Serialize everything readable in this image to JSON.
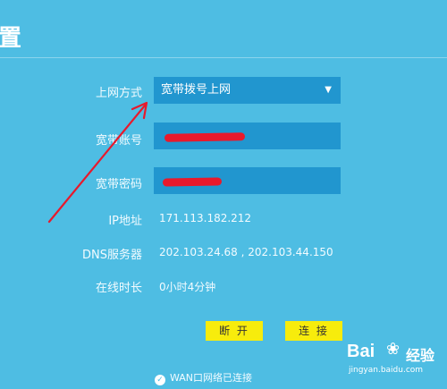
{
  "header": {
    "title": "置"
  },
  "form": {
    "connection_type_label": "上网方式",
    "connection_type_value": "宽带拨号上网",
    "account_label": "宽带账号",
    "password_label": "宽带密码",
    "ip_label": "IP地址",
    "ip_value": "171.113.182.212",
    "dns_label": "DNS服务器",
    "dns_value": "202.103.24.68 , 202.103.44.150",
    "uptime_label": "在线时长",
    "uptime_value": "0小时4分钟"
  },
  "buttons": {
    "disconnect": "断 开",
    "connect": "连 接"
  },
  "status": {
    "text": "WAN口网络已连接"
  },
  "watermark": {
    "logo": "Bai",
    "cn": "经验",
    "url": "jingyan.baidu.com"
  },
  "colors": {
    "background": "#4ebde3",
    "field": "#2196cf",
    "button": "#f7ec0c",
    "annotation": "#e8192c"
  }
}
